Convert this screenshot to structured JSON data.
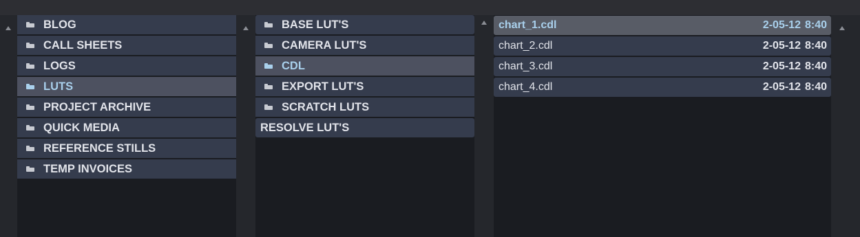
{
  "colors": {
    "row_bg": "#353c4d",
    "row_selected_bg": "#585c66",
    "selected_text": "#a9d0ec",
    "text": "#e2e4ea",
    "background": "#1b1d22"
  },
  "column1": {
    "items": [
      {
        "label": "BLOG",
        "icon": "folder-icon"
      },
      {
        "label": "CALL SHEETS",
        "icon": "folder-icon"
      },
      {
        "label": "LOGS",
        "icon": "folder-icon"
      },
      {
        "label": "LUTS",
        "icon": "folder-icon",
        "selected": true
      },
      {
        "label": "PROJECT ARCHIVE",
        "icon": "folder-icon"
      },
      {
        "label": "QUICK MEDIA",
        "icon": "folder-icon"
      },
      {
        "label": "REFERENCE STILLS",
        "icon": "folder-icon"
      },
      {
        "label": "TEMP INVOICES",
        "icon": "folder-icon"
      }
    ]
  },
  "column2": {
    "items": [
      {
        "label": "BASE LUT'S",
        "icon": "folder-icon"
      },
      {
        "label": "CAMERA LUT'S",
        "icon": "folder-icon"
      },
      {
        "label": "CDL",
        "icon": "folder-icon",
        "selected": true
      },
      {
        "label": "EXPORT LUT'S",
        "icon": "folder-icon"
      },
      {
        "label": "SCRATCH LUTS",
        "icon": "folder-icon"
      },
      {
        "label": "RESOLVE LUT'S"
      }
    ]
  },
  "column3": {
    "files": [
      {
        "name": "chart_1.cdl",
        "date": "2-05-12",
        "time": "8:40",
        "selected": true
      },
      {
        "name": "chart_2.cdl",
        "date": "2-05-12",
        "time": "8:40"
      },
      {
        "name": "chart_3.cdl",
        "date": "2-05-12",
        "time": "8:40"
      },
      {
        "name": "chart_4.cdl",
        "date": "2-05-12",
        "time": "8:40"
      }
    ]
  }
}
